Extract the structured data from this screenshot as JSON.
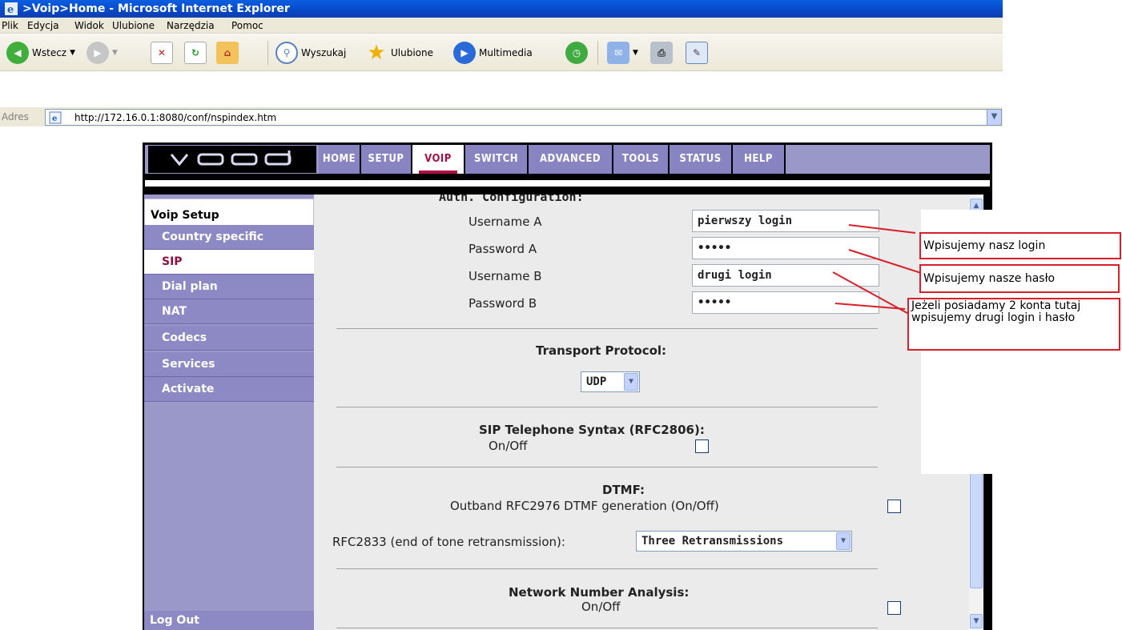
{
  "window": {
    "title": ">Voip>Home - Microsoft Internet Explorer"
  },
  "menubar": [
    "Plik",
    "Edycja",
    "Widok",
    "Ulubione",
    "Narzędzia",
    "Pomoc"
  ],
  "toolbar": {
    "back_label": "Wstecz",
    "search_label": "Wyszukaj",
    "favorites_label": "Ulubione",
    "media_label": "Multimedia"
  },
  "address": {
    "label": "Adres",
    "url": "http://172.16.0.1:8080/conf/nspindex.htm"
  },
  "brand": {
    "logo": "vood"
  },
  "nav": {
    "tabs": [
      "HOME",
      "SETUP",
      "VOIP",
      "SWITCH",
      "ADVANCED",
      "TOOLS",
      "STATUS",
      "HELP"
    ],
    "active": "VOIP"
  },
  "sidebar": {
    "heading": "Voip Setup",
    "items": [
      "Country specific",
      "SIP",
      "Dial plan",
      "NAT",
      "Codecs",
      "Services",
      "Activate"
    ],
    "active": "SIP",
    "logout": "Log Out"
  },
  "auth": {
    "section_title": "Auth. Configuration:",
    "username_a_label": "Username A",
    "username_a_value": "pierwszy login",
    "password_a_label": "Password A",
    "password_a_value": "•••••",
    "username_b_label": "Username B",
    "username_b_value": "drugi login",
    "password_b_label": "Password B",
    "password_b_value": "•••••"
  },
  "transport": {
    "title": "Transport Protocol:",
    "value": "UDP"
  },
  "sip_syntax": {
    "title": "SIP Telephone Syntax (RFC2806):",
    "onoff": "On/Off",
    "checked": false
  },
  "dtmf": {
    "title": "DTMF:",
    "outband_label": "Outband RFC2976 DTMF generation (On/Off)",
    "outband_checked": false,
    "rfc2833_label": "RFC2833 (end of tone retransmission):",
    "rfc2833_value": "Three Retransmissions"
  },
  "nna": {
    "title": "Network Number Analysis:",
    "onoff": "On/Off",
    "checked": false
  },
  "annotations": {
    "login": "Wpisujemy nasz login",
    "password": "Wpisujemy nasze hasło",
    "second_account": "Jeżeli posiadamy 2 konta tutaj wpisujemy drugi login i hasło",
    "line_color": "#d81f2a"
  }
}
